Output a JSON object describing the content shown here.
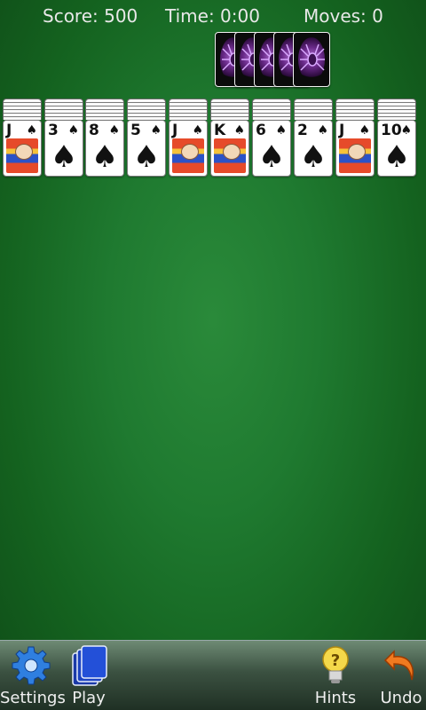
{
  "status": {
    "score": "Score: 500",
    "time": "Time: 0:00",
    "moves": "Moves: 0"
  },
  "stock": {
    "count": 5
  },
  "tableau": [
    {
      "rank": "J",
      "suit": "♠",
      "face": true
    },
    {
      "rank": "3",
      "suit": "♠",
      "face": false
    },
    {
      "rank": "8",
      "suit": "♠",
      "face": false
    },
    {
      "rank": "5",
      "suit": "♠",
      "face": false
    },
    {
      "rank": "J",
      "suit": "♠",
      "face": true
    },
    {
      "rank": "K",
      "suit": "♠",
      "face": true
    },
    {
      "rank": "6",
      "suit": "♠",
      "face": false
    },
    {
      "rank": "2",
      "suit": "♠",
      "face": false
    },
    {
      "rank": "J",
      "suit": "♠",
      "face": true
    },
    {
      "rank": "10",
      "suit": "♠",
      "face": false
    }
  ],
  "toolbar": {
    "settings_label": "Settings",
    "play_label": "Play",
    "hints_label": "Hints",
    "undo_label": "Undo"
  },
  "icons": {
    "settings": "gear-icon",
    "play": "card-deck-icon",
    "hints": "lightbulb-icon",
    "undo": "undo-arrow-icon"
  },
  "colors": {
    "felt": "#1f7a30",
    "toolbar": "#3b5141",
    "gear": "#2f7fe0",
    "deck": "#1b3aa8",
    "bulb": "#f4d84a",
    "undo": "#f07a20"
  }
}
